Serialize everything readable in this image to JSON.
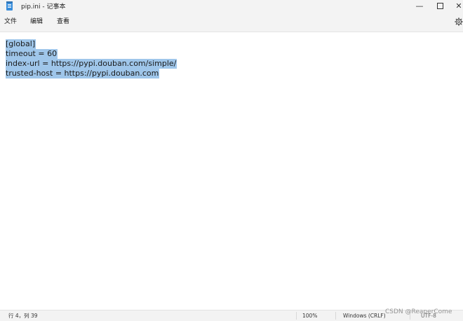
{
  "window": {
    "title": "pip.ini - 记事本",
    "minimize_glyph": "—",
    "close_glyph": "✕"
  },
  "menu": {
    "file": "文件",
    "edit": "编辑",
    "view": "查看"
  },
  "editor": {
    "lines": [
      "[global]",
      "timeout = 60",
      "index-url = https://pypi.douban.com/simple/",
      "trusted-host = https://pypi.douban.com"
    ],
    "selection_color": "#9fc6ea"
  },
  "status": {
    "position": "行 4，列 39",
    "zoom": "100%",
    "line_ending": "Windows (CRLF)",
    "encoding": "UTF-8"
  },
  "watermark": "CSDN @ReaperCome",
  "icons": {
    "app": "notepad-icon",
    "settings": "gear-icon"
  }
}
